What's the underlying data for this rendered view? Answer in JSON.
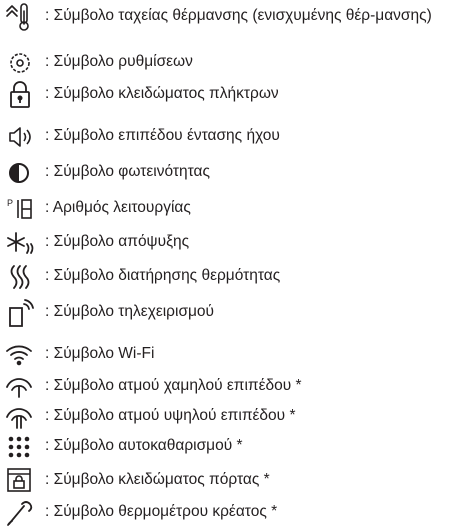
{
  "legend": {
    "items": [
      {
        "icon": "rapid-heating-icon",
        "text": ": Σύμβολο ταχείας θέρμανσης (ενισχυμένης θέρ-μανσης)"
      },
      {
        "icon": "settings-icon",
        "text": ": Σύμβολο ρυθμίσεων"
      },
      {
        "icon": "key-lock-icon",
        "text": ": Σύμβολο κλειδώματος πλήκτρων"
      },
      {
        "icon": "volume-icon",
        "text": ": Σύμβολο επιπέδου έντασης ήχου"
      },
      {
        "icon": "brightness-icon",
        "text": ": Σύμβολο φωτεινότητας"
      },
      {
        "icon": "program-number-icon",
        "text": ": Αριθμός λειτουργίας",
        "icon_text": "P"
      },
      {
        "icon": "defrost-icon",
        "text": ": Σύμβολο απόψυξης"
      },
      {
        "icon": "keep-warm-icon",
        "text": ": Σύμβολο διατήρησης θερμότητας"
      },
      {
        "icon": "remote-control-icon",
        "text": ": Σύμβολο τηλεχειρισμού"
      },
      {
        "icon": "wifi-icon",
        "text": ": Σύμβολο Wi-Fi"
      },
      {
        "icon": "steam-low-icon",
        "text": ": Σύμβολο ατμού χαμηλού επιπέδου *"
      },
      {
        "icon": "steam-high-icon",
        "text": ": Σύμβολο ατμού υψηλού επιπέδου *"
      },
      {
        "icon": "self-cleaning-icon",
        "text": ": Σύμβολο αυτοκαθαρισμού *"
      },
      {
        "icon": "door-lock-icon",
        "text": ": Σύμβολο κλειδώματος πόρτας *"
      },
      {
        "icon": "meat-probe-icon",
        "text": ": Σύμβολο θερμομέτρου κρέατος *"
      }
    ]
  }
}
